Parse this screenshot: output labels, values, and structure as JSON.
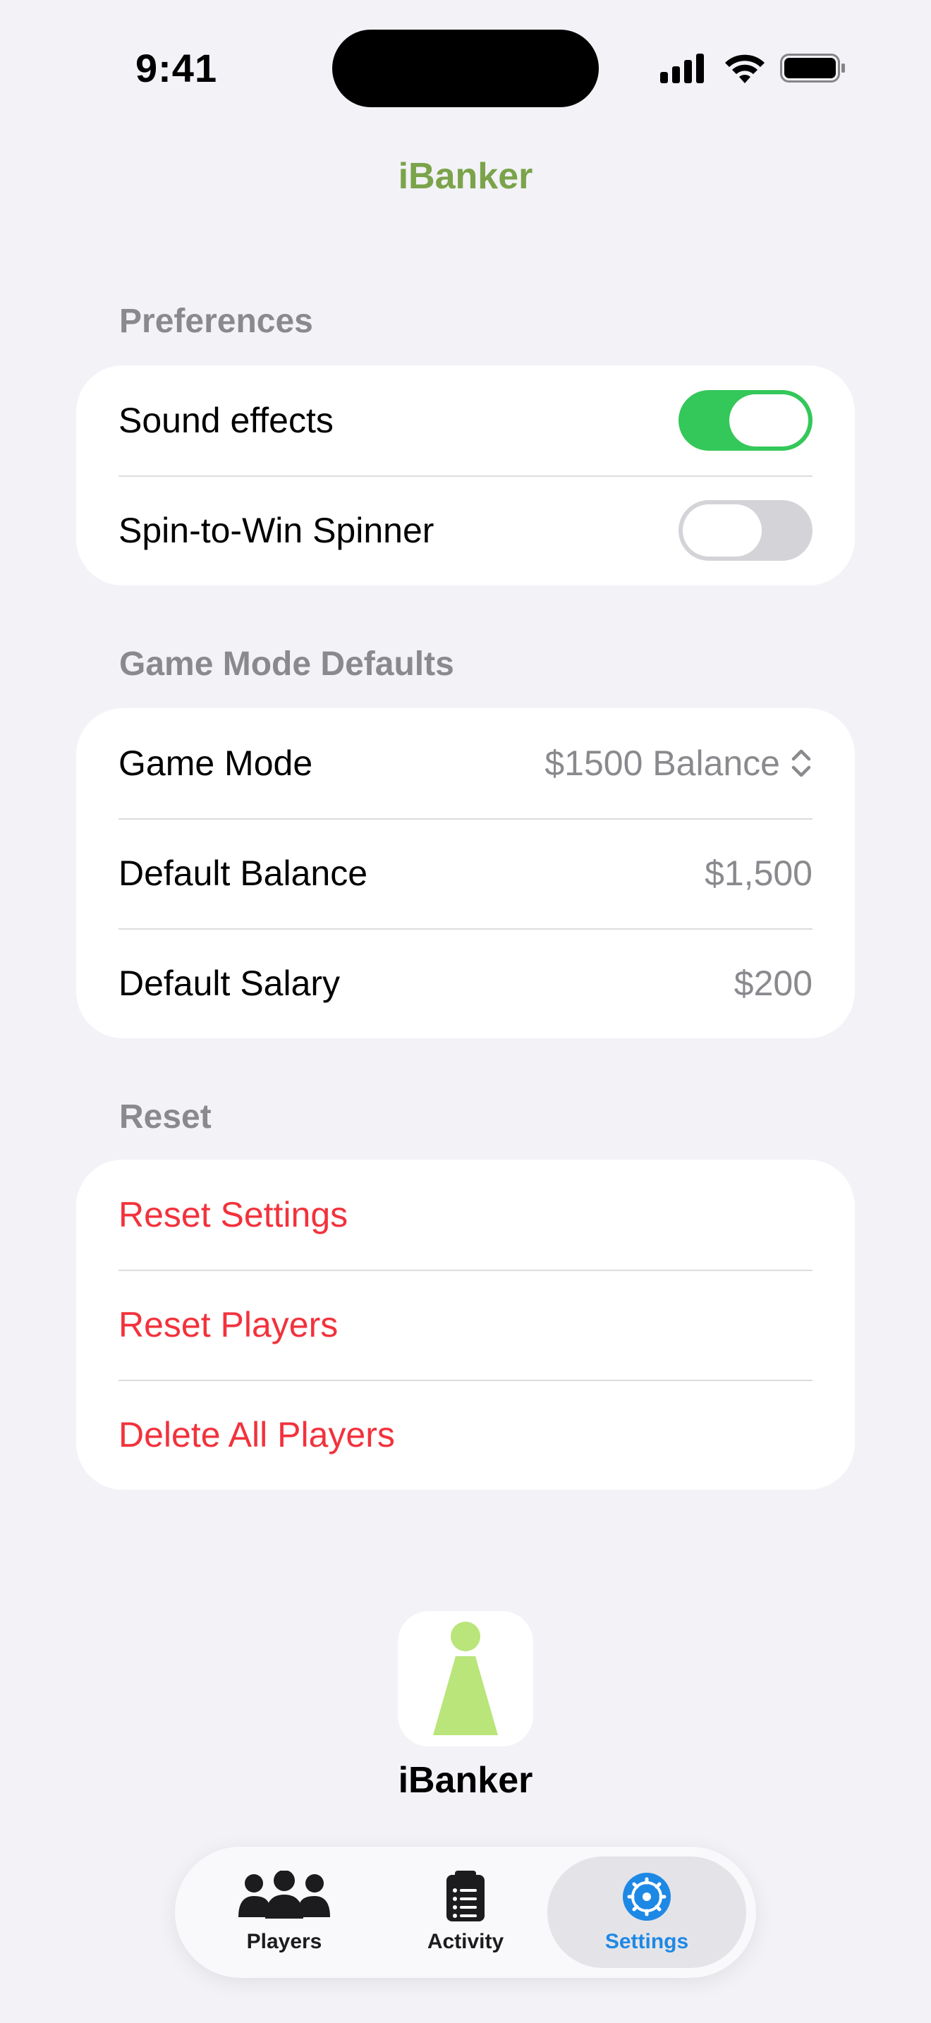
{
  "status_bar": {
    "time": "9:41"
  },
  "nav": {
    "title": "iBanker",
    "title_color": "#7BA34A"
  },
  "preferences": {
    "header": "Preferences",
    "rows": [
      {
        "label": "Sound effects",
        "toggle_on": true
      },
      {
        "label": "Spin-to-Win Spinner",
        "toggle_on": false
      }
    ]
  },
  "game_mode_defaults": {
    "header": "Game Mode Defaults",
    "game_mode": {
      "label": "Game Mode",
      "value": "$1500 Balance"
    },
    "default_balance": {
      "label": "Default Balance",
      "value": "$1,500"
    },
    "default_salary": {
      "label": "Default Salary",
      "value": "$200"
    }
  },
  "reset": {
    "header": "Reset",
    "reset_settings": "Reset Settings",
    "reset_players": "Reset Players",
    "delete_all_players": "Delete All Players",
    "color": "#F2323C"
  },
  "app_info": {
    "name": "iBanker",
    "logo_color": "#B9E57A"
  },
  "tab_bar": {
    "tabs": [
      {
        "label": "Players",
        "icon": "people-icon",
        "selected": false
      },
      {
        "label": "Activity",
        "icon": "clipboard-icon",
        "selected": false
      },
      {
        "label": "Settings",
        "icon": "gear-icon",
        "selected": true
      }
    ],
    "accent": "#1E88E5"
  },
  "colors": {
    "background": "#F2F2F7",
    "toggle_on": "#34C759",
    "secondary_text": "#8A8A8E"
  }
}
